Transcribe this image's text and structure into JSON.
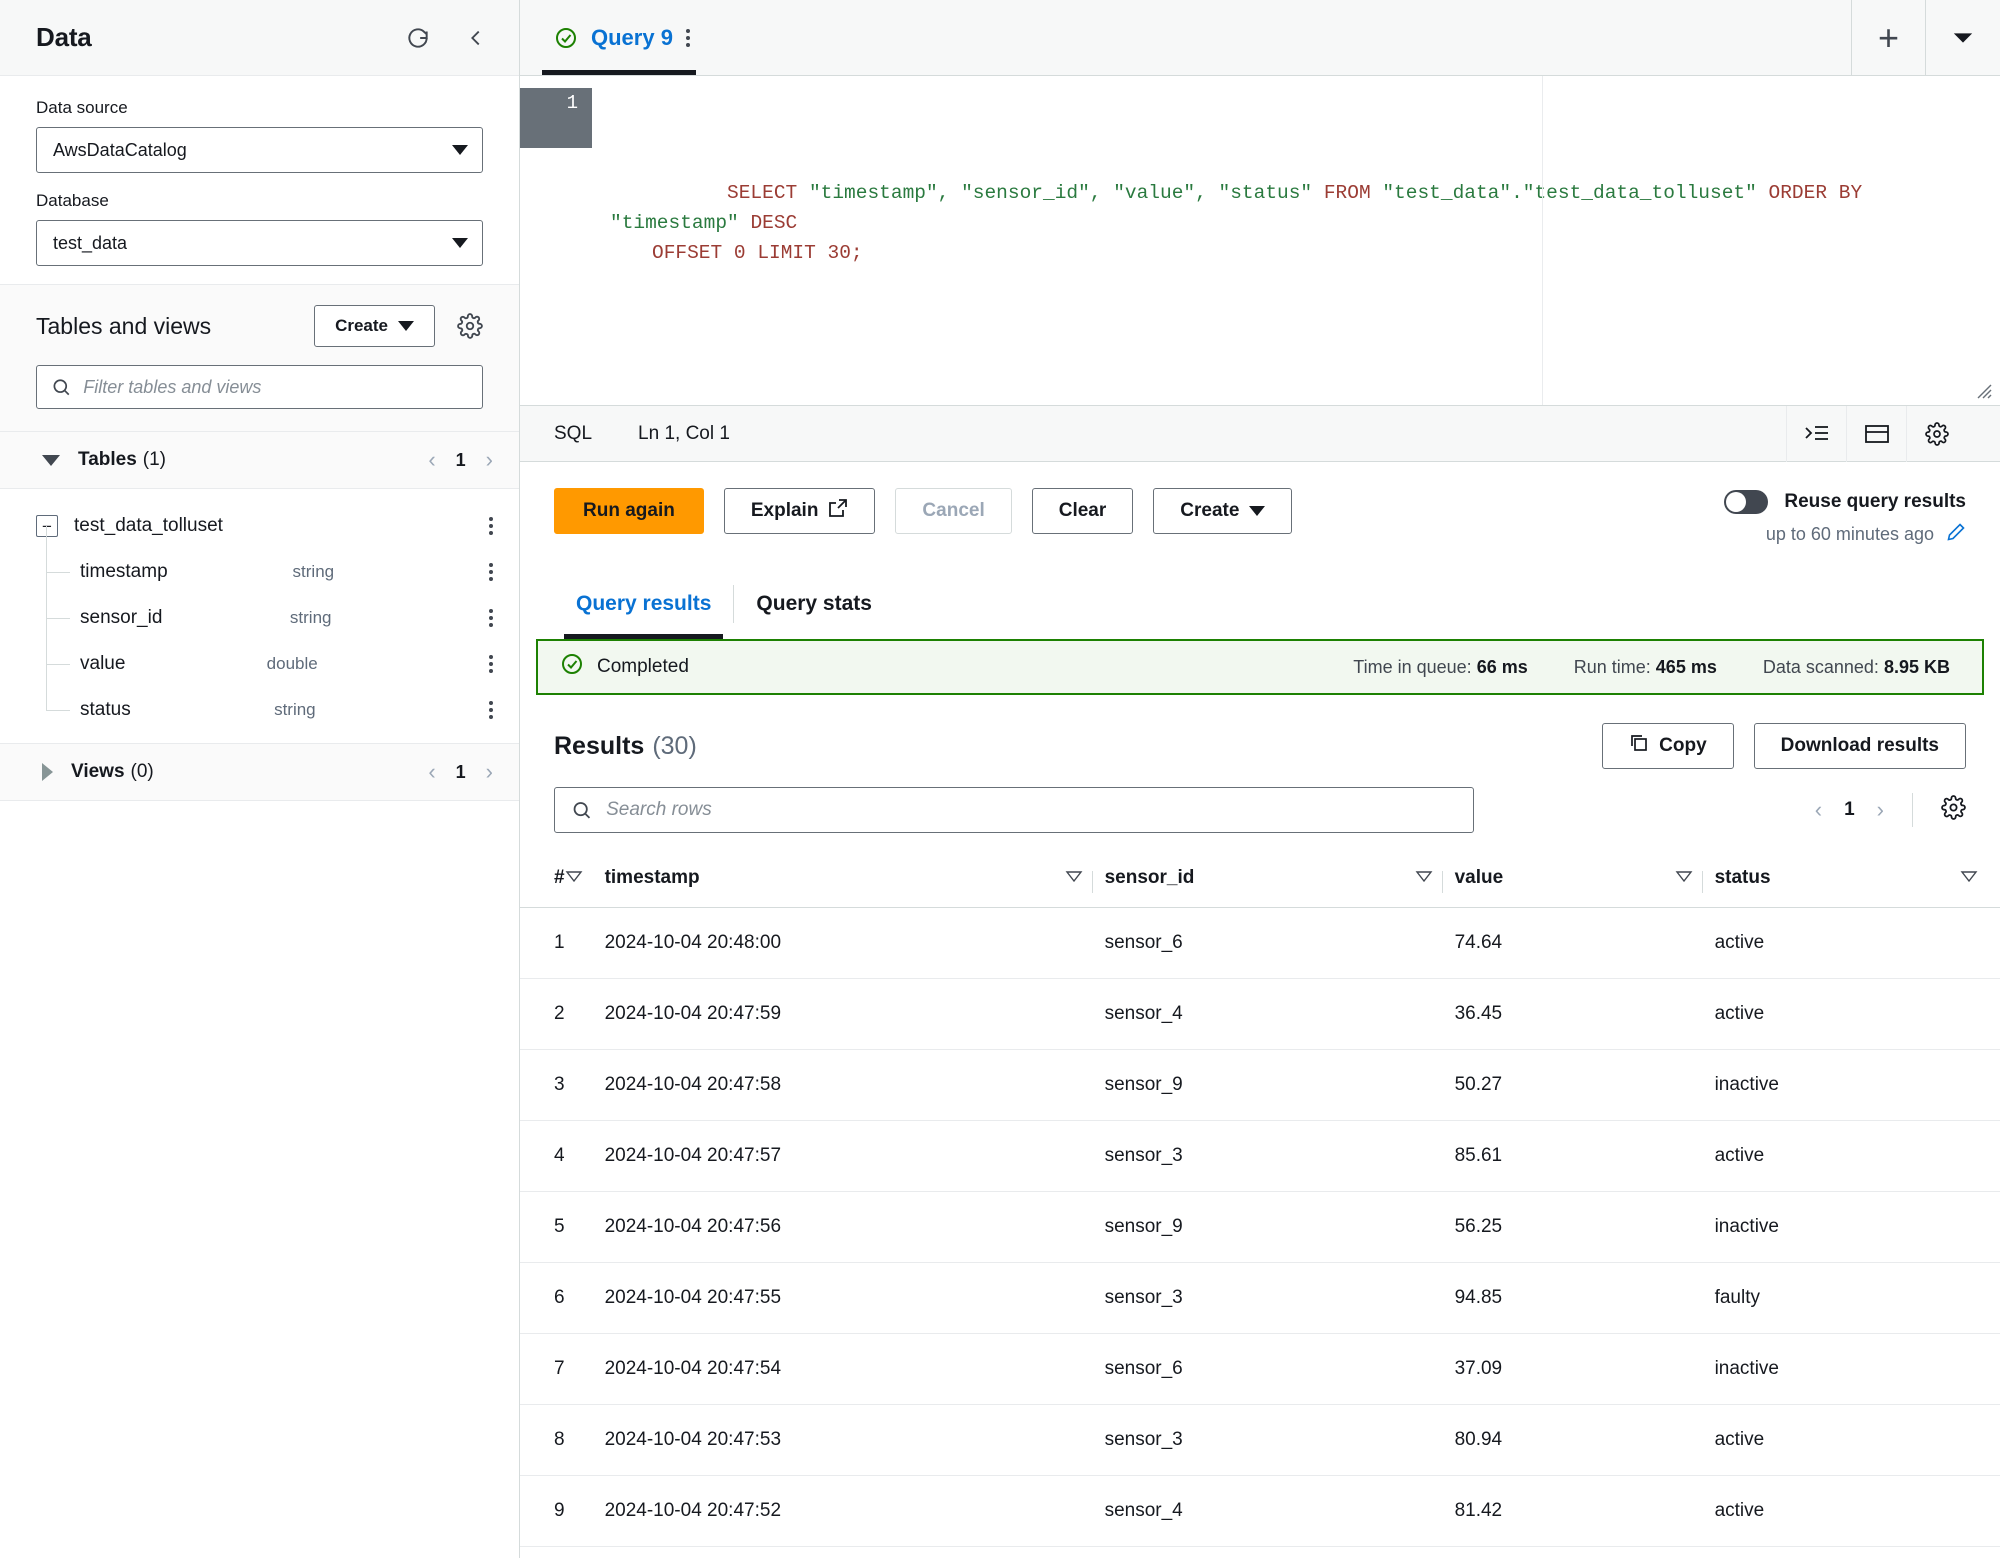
{
  "sidebar": {
    "title": "Data",
    "refresh_icon": "refresh-icon",
    "collapse_icon": "chevron-left-icon",
    "data_source": {
      "label": "Data source",
      "value": "AwsDataCatalog"
    },
    "database": {
      "label": "Database",
      "value": "test_data"
    },
    "tables_and_views": {
      "title": "Tables and views",
      "create_label": "Create",
      "settings_icon": "gear-icon",
      "filter_placeholder": "Filter tables and views"
    },
    "tables_group": {
      "name": "Tables",
      "count": "(1)",
      "page": "1"
    },
    "table": {
      "name": "test_data_tolluset",
      "columns": [
        {
          "name": "timestamp",
          "type": "string"
        },
        {
          "name": "sensor_id",
          "type": "string"
        },
        {
          "name": "value",
          "type": "double"
        },
        {
          "name": "status",
          "type": "string"
        }
      ]
    },
    "views_group": {
      "name": "Views",
      "count": "(0)",
      "page": "1"
    }
  },
  "editor": {
    "tab": {
      "label": "Query 9",
      "status_icon": "check-circle-icon"
    },
    "add_tab_label": "+",
    "tab_menu_icon": "chevron-down-icon",
    "line_number": "1",
    "sql": {
      "line1_kw1": "SELECT",
      "line1_cols": " \"timestamp\", \"sensor_id\", \"value\", \"status\" ",
      "line1_kw2": "FROM",
      "line1_table": " \"test_data\".\"test_data_tolluset\" ",
      "line1_kw3": "ORDER BY",
      "line1_ts": " \"timestamp\" ",
      "line1_kw4": "DESC",
      "line2": "OFFSET 0 LIMIT 30;"
    },
    "status": {
      "language": "SQL",
      "cursor": "Ln 1, Col 1"
    },
    "status_icons": [
      "format-icon",
      "panel-icon",
      "gear-icon"
    ]
  },
  "actions": {
    "run_again": "Run again",
    "explain": "Explain",
    "explain_icon": "external-link-icon",
    "cancel": "Cancel",
    "clear": "Clear",
    "create": "Create",
    "reuse_label": "Reuse query results",
    "reuse_sub": "up to 60 minutes ago",
    "reuse_edit_icon": "pencil-icon",
    "reuse_enabled": false
  },
  "result_tabs": [
    {
      "label": "Query results",
      "active": true
    },
    {
      "label": "Query stats",
      "active": false
    }
  ],
  "status_banner": {
    "state": "Completed",
    "state_icon": "check-circle-icon",
    "metrics": [
      {
        "label": "Time in queue:",
        "value": "66 ms"
      },
      {
        "label": "Run time:",
        "value": "465 ms"
      },
      {
        "label": "Data scanned:",
        "value": "8.95 KB"
      }
    ]
  },
  "results": {
    "title": "Results",
    "count": "(30)",
    "copy_label": "Copy",
    "copy_icon": "copy-icon",
    "download_label": "Download results",
    "search_placeholder": "Search rows",
    "page": "1",
    "settings_icon": "gear-icon",
    "columns": [
      "#",
      "timestamp",
      "sensor_id",
      "value",
      "status"
    ],
    "rows": [
      {
        "n": "1",
        "timestamp": "2024-10-04 20:48:00",
        "sensor_id": "sensor_6",
        "value": "74.64",
        "status": "active"
      },
      {
        "n": "2",
        "timestamp": "2024-10-04 20:47:59",
        "sensor_id": "sensor_4",
        "value": "36.45",
        "status": "active"
      },
      {
        "n": "3",
        "timestamp": "2024-10-04 20:47:58",
        "sensor_id": "sensor_9",
        "value": "50.27",
        "status": "inactive"
      },
      {
        "n": "4",
        "timestamp": "2024-10-04 20:47:57",
        "sensor_id": "sensor_3",
        "value": "85.61",
        "status": "active"
      },
      {
        "n": "5",
        "timestamp": "2024-10-04 20:47:56",
        "sensor_id": "sensor_9",
        "value": "56.25",
        "status": "inactive"
      },
      {
        "n": "6",
        "timestamp": "2024-10-04 20:47:55",
        "sensor_id": "sensor_3",
        "value": "94.85",
        "status": "faulty"
      },
      {
        "n": "7",
        "timestamp": "2024-10-04 20:47:54",
        "sensor_id": "sensor_6",
        "value": "37.09",
        "status": "inactive"
      },
      {
        "n": "8",
        "timestamp": "2024-10-04 20:47:53",
        "sensor_id": "sensor_3",
        "value": "80.94",
        "status": "active"
      },
      {
        "n": "9",
        "timestamp": "2024-10-04 20:47:52",
        "sensor_id": "sensor_4",
        "value": "81.42",
        "status": "active"
      }
    ]
  },
  "colors": {
    "accent": "#0972d3",
    "primary_button": "#ff9900",
    "success": "#1d8102",
    "success_bg": "#f2f8f0"
  }
}
